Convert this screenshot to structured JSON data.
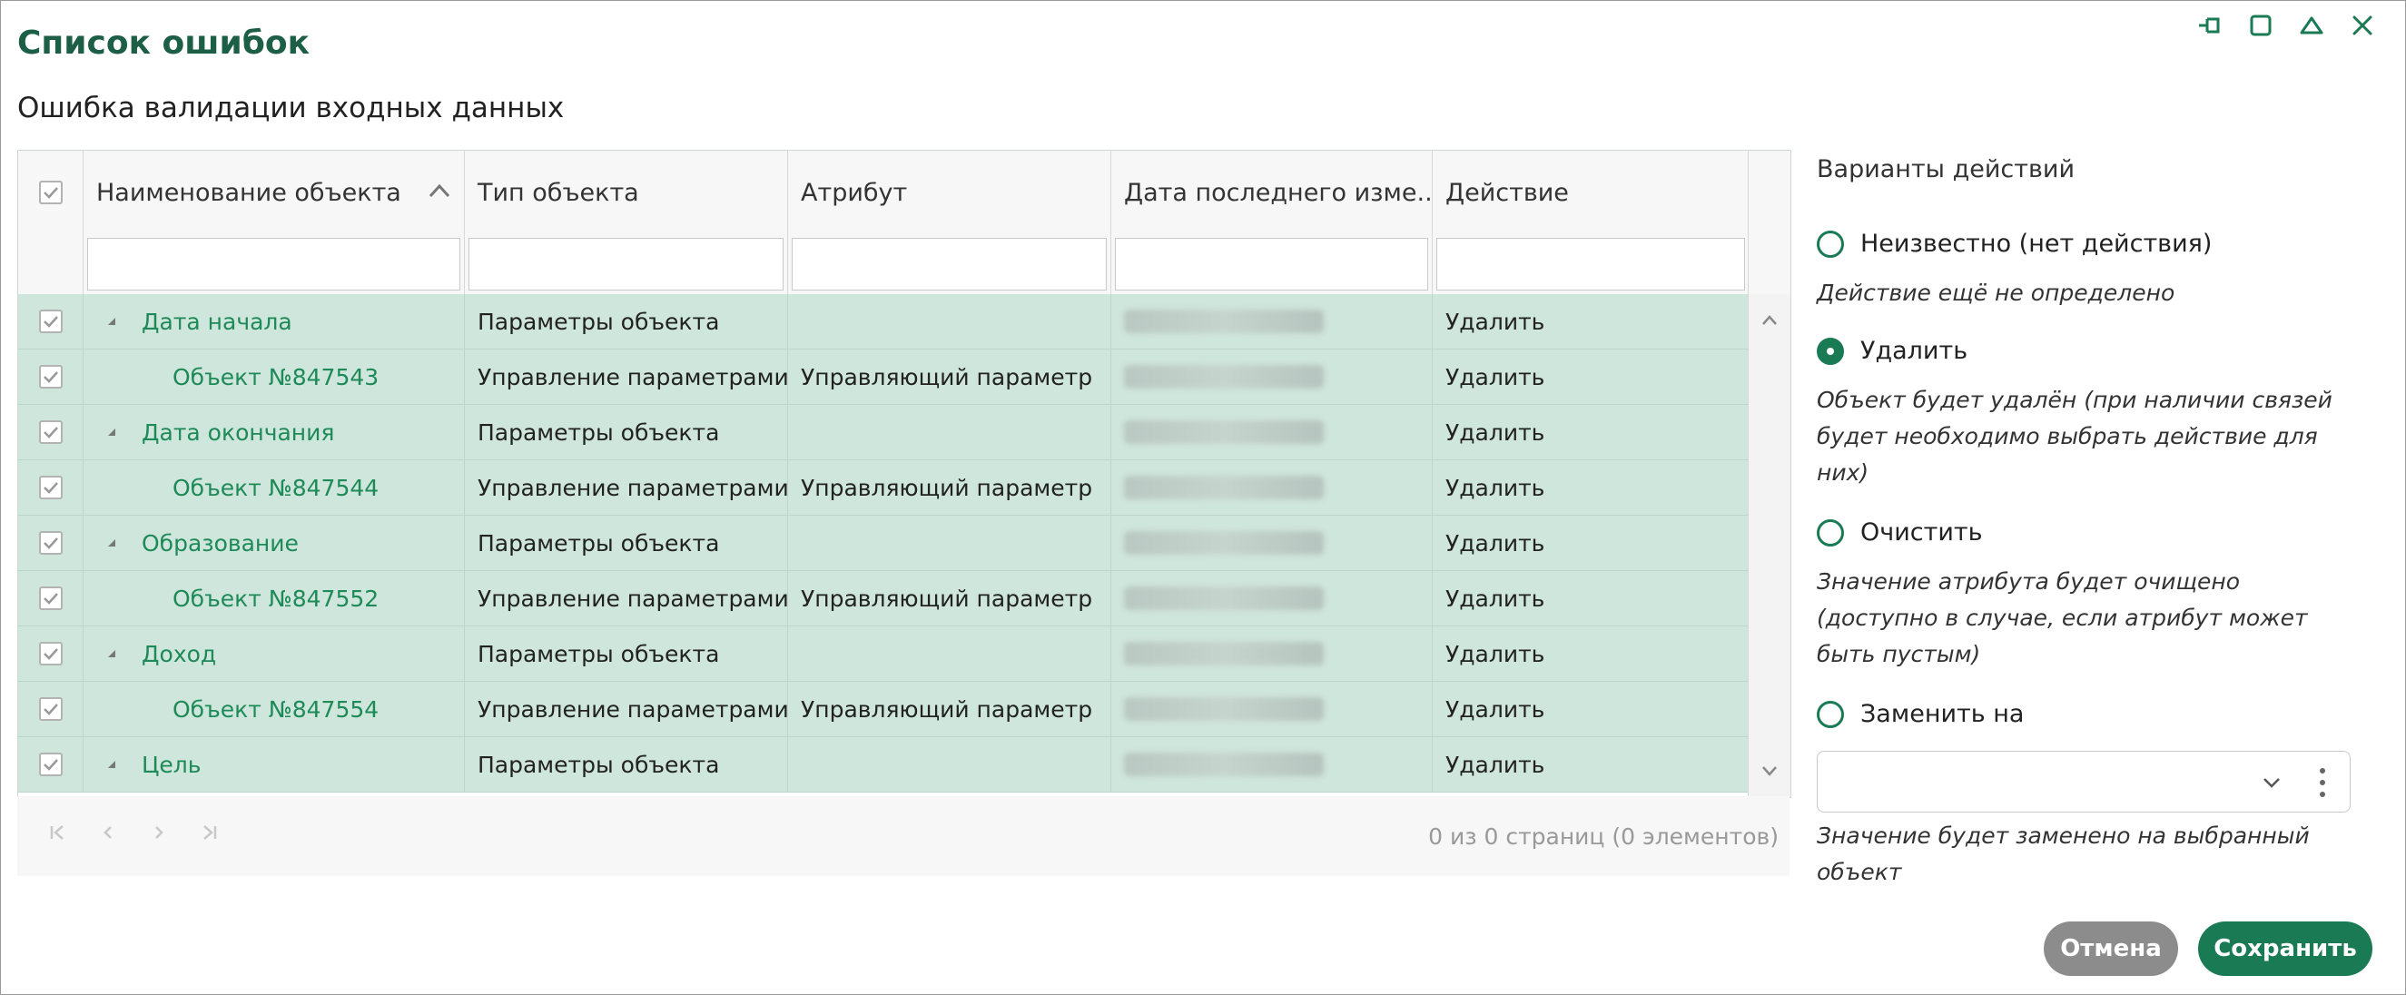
{
  "dialog": {
    "title": "Список ошибок",
    "subtitle": "Ошибка валидации входных данных"
  },
  "grid": {
    "columns": [
      "Наименование объекта",
      "Тип объекта",
      "Атрибут",
      "Дата последнего изме...",
      "Действие"
    ],
    "rows": [
      {
        "name": "Дата начала",
        "type": "Параметры объекта",
        "attribute": "",
        "action": "Удалить",
        "level": 0
      },
      {
        "name": "Объект №847543",
        "type": "Управление параметрами",
        "attribute": "Управляющий параметр",
        "action": "Удалить",
        "level": 1
      },
      {
        "name": "Дата окончания",
        "type": "Параметры объекта",
        "attribute": "",
        "action": "Удалить",
        "level": 0
      },
      {
        "name": "Объект №847544",
        "type": "Управление параметрами",
        "attribute": "Управляющий параметр",
        "action": "Удалить",
        "level": 1
      },
      {
        "name": "Образование",
        "type": "Параметры объекта",
        "attribute": "",
        "action": "Удалить",
        "level": 0
      },
      {
        "name": "Объект №847552",
        "type": "Управление параметрами",
        "attribute": "Управляющий параметр",
        "action": "Удалить",
        "level": 1
      },
      {
        "name": "Доход",
        "type": "Параметры объекта",
        "attribute": "",
        "action": "Удалить",
        "level": 0
      },
      {
        "name": "Объект №847554",
        "type": "Управление параметрами",
        "attribute": "Управляющий параметр",
        "action": "Удалить",
        "level": 1
      },
      {
        "name": "Цель",
        "type": "Параметры объекта",
        "attribute": "",
        "action": "Удалить",
        "level": 0
      }
    ],
    "pager_info": "0 из 0 страниц (0 элементов)"
  },
  "panel": {
    "title": "Варианты действий",
    "options": [
      {
        "label": "Неизвестно (нет действия)",
        "description": "Действие ещё не определено",
        "selected": false
      },
      {
        "label": "Удалить",
        "description": "Объект будет удалён (при наличии связей будет необходимо выбрать действие для них)",
        "selected": true
      },
      {
        "label": "Очистить",
        "description": "Значение атрибута будет очищено (доступно в случае, если атрибут может быть пустым)",
        "selected": false
      },
      {
        "label": "Заменить на",
        "description": "Значение будет заменено на выбранный объект",
        "selected": false
      }
    ]
  },
  "buttons": {
    "cancel": "Отмена",
    "save": "Сохранить"
  },
  "colors": {
    "accent": "#1a7a54",
    "title": "#1d5e46",
    "row_selected": "#cfe6dc",
    "link": "#1e8a58"
  }
}
